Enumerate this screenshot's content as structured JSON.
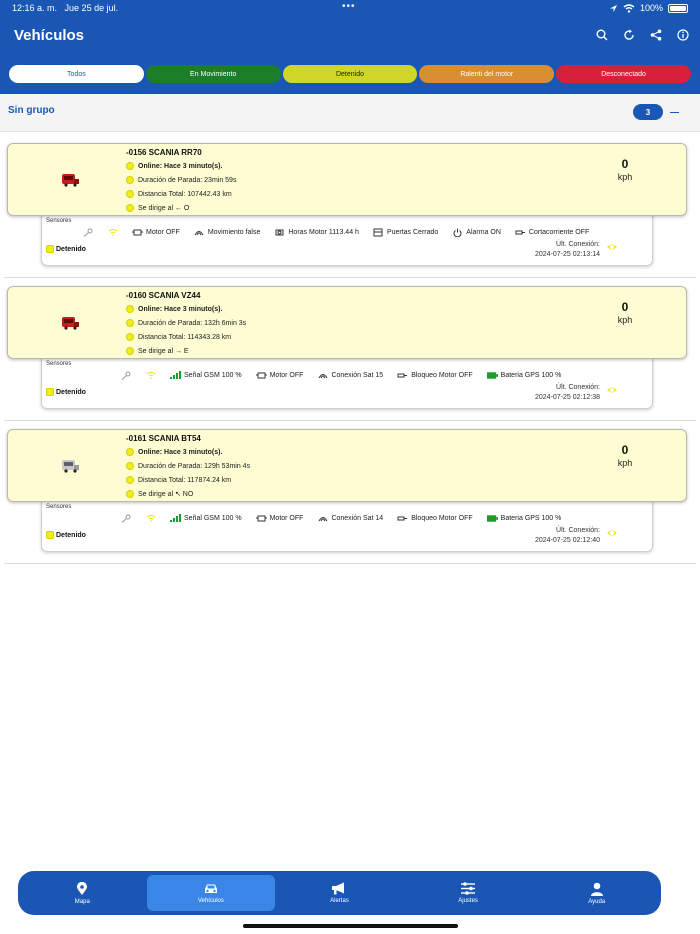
{
  "status_bar": {
    "time": "12:16 a. m.",
    "date": "Jue 25 de jul.",
    "battery": "100%"
  },
  "header": {
    "title": "Vehículos"
  },
  "filters": [
    "Todos",
    "En Movimiento",
    "Detenido",
    "Ralenti del motor",
    "Desconectado"
  ],
  "group": {
    "name": "Sin grupo",
    "count": "3"
  },
  "vehicles": [
    {
      "name": "-0156 SCANIA RR70",
      "online": "Online: Hace 3 minuto(s).",
      "parada": "Duración de Parada: 23min 59s",
      "distancia": "Distancia Total: 107442.43 km",
      "direccion": "Se dirige al ← O",
      "speed": "0",
      "unit": "kph",
      "sensores_label": "Sensores",
      "sensors": [
        "Motor OFF",
        "Movimiento false",
        "Horas Motor 1113.44 h",
        "Puertas Cerrado",
        "Alarma ON",
        "Cortacorriente OFF"
      ],
      "estado": "Detenido",
      "ult_label": "Últ. Conexión:",
      "ult_fecha": "2024-07-25 02:13:14"
    },
    {
      "name": "-0160 SCANIA VZ44",
      "online": "Online: Hace 3 minuto(s).",
      "parada": "Duración de Parada: 132h 6min 3s",
      "distancia": "Distancia Total: 114343.28 km",
      "direccion": "Se dirige al → E",
      "speed": "0",
      "unit": "kph",
      "sensores_label": "Sensores",
      "sensors": [
        "Señal GSM 100 %",
        "Motor OFF",
        "Conexión Sat 15",
        "Bloqueo Motor OFF",
        "Bateria GPS 100 %"
      ],
      "estado": "Detenido",
      "ult_label": "Últ. Conexión:",
      "ult_fecha": "2024-07-25 02:12:38"
    },
    {
      "name": "-0161 SCANIA BT54",
      "online": "Online: Hace 3 minuto(s).",
      "parada": "Duración de Parada: 129h 53min 4s",
      "distancia": "Distancia Total: 117874.24 km",
      "direccion": "Se dirige al ↖ NO",
      "speed": "0",
      "unit": "kph",
      "sensores_label": "Sensores",
      "sensors": [
        "Señal GSM 100 %",
        "Motor OFF",
        "Conexión Sat 14",
        "Bloqueo Motor OFF",
        "Bateria GPS 100 %"
      ],
      "estado": "Detenido",
      "ult_label": "Últ. Conexión:",
      "ult_fecha": "2024-07-25 02:12:40"
    }
  ],
  "nav": [
    "Mapa",
    "Vehículos",
    "Alertas",
    "Ajustes",
    "Ayuda"
  ],
  "colors": {
    "primary": "#1a57b4",
    "movimiento": "#1c7d2b",
    "detenido": "#cfd627",
    "ralenti": "#d88f31",
    "desconectado": "#d8203c",
    "card_bg": "#fdfcd2"
  }
}
